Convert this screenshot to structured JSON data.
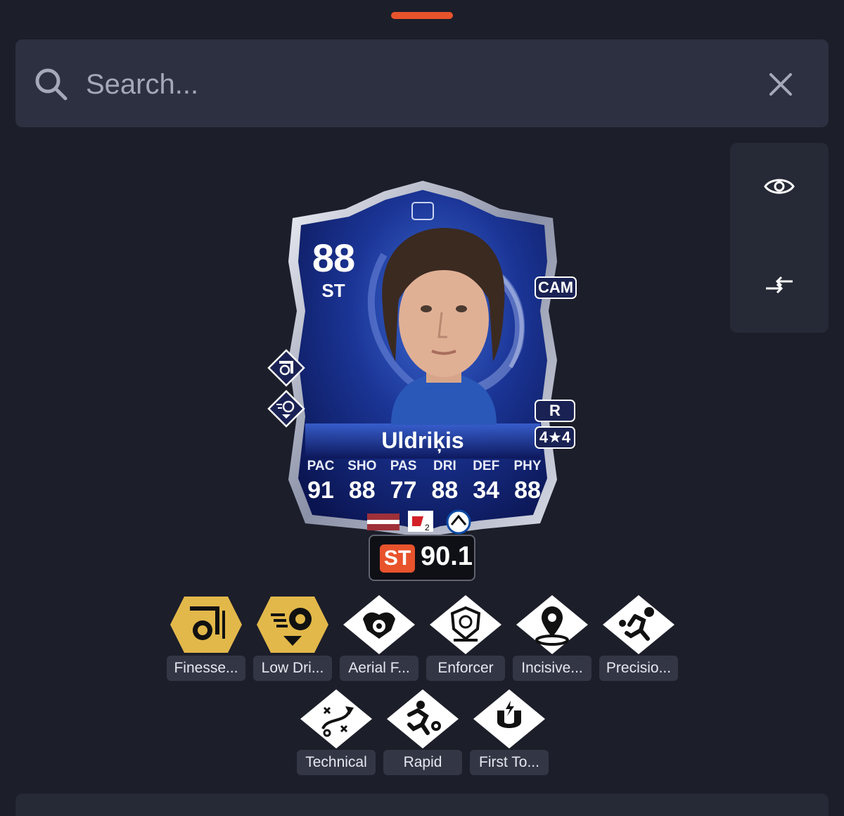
{
  "search": {
    "placeholder": "Search..."
  },
  "icons": {
    "search": "search-icon",
    "clear": "close-icon",
    "view": "eye-icon",
    "compare": "compare-arrows-icon"
  },
  "colors": {
    "accent": "#e8532c",
    "background": "#1c1e2a",
    "panel": "#2d3040",
    "gold": "#e2b84a"
  },
  "card": {
    "rating": "88",
    "position": "ST",
    "alt_position": "CAM",
    "preferred_foot": "R",
    "skill_weak": "4★4",
    "name": "Uldriķis",
    "stats": [
      {
        "label": "PAC",
        "value": "91"
      },
      {
        "label": "SHO",
        "value": "88"
      },
      {
        "label": "PAS",
        "value": "77"
      },
      {
        "label": "DRI",
        "value": "88"
      },
      {
        "label": "DEF",
        "value": "34"
      },
      {
        "label": "PHY",
        "value": "88"
      }
    ]
  },
  "chip": {
    "position": "ST",
    "value": "90.1"
  },
  "playstyles": [
    {
      "label": "Finesse...",
      "plus": true
    },
    {
      "label": "Low Dri...",
      "plus": true
    },
    {
      "label": "Aerial F...",
      "plus": false
    },
    {
      "label": "Enforcer",
      "plus": false
    },
    {
      "label": "Incisive...",
      "plus": false
    },
    {
      "label": "Precisio...",
      "plus": false
    },
    {
      "label": "Technical",
      "plus": false
    },
    {
      "label": "Rapid",
      "plus": false
    },
    {
      "label": "First To...",
      "plus": false
    }
  ]
}
